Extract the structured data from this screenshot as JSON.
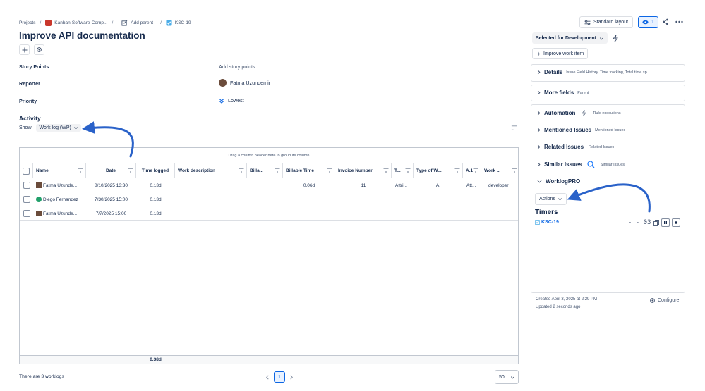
{
  "breadcrumb": {
    "projects": "Projects",
    "project": "Kanban-Software-Comp...",
    "add_parent": "Add parent",
    "issue_key": "KSC-19",
    "separator": "/"
  },
  "issue": {
    "title": "Improve API documentation"
  },
  "fields": {
    "story_points_label": "Story Points",
    "story_points_value": "Add story points",
    "reporter_label": "Reporter",
    "reporter_value": "Fatma Uzundemir",
    "priority_label": "Priority",
    "priority_value": "Lowest"
  },
  "activity": {
    "heading": "Activity",
    "show_label": "Show:",
    "show_value": "Work log (WP)"
  },
  "grid": {
    "hint": "Drag a column header here to group its column",
    "columns": [
      "Name",
      "Date",
      "Time logged",
      "Work description",
      "Billa...",
      "Billable Time",
      "Invoice Number",
      "T...",
      "Type of W...",
      "A.1",
      "Work ..."
    ],
    "rows": [
      {
        "name": "Fatma Uzunde...",
        "date": "8/10/2025 13:30",
        "time": "0.13d",
        "desc": "",
        "billa": "",
        "billable_time": "0.06d",
        "invoice": "11",
        "t": "Attri...",
        "type": "A.",
        "a1": "Att...",
        "work": "developer"
      },
      {
        "name": "Diego Fernandez",
        "date": "7/30/2025 15:00",
        "time": "0.13d",
        "desc": "",
        "billa": "",
        "billable_time": "",
        "invoice": "",
        "t": "",
        "type": "",
        "a1": "",
        "work": ""
      },
      {
        "name": "Fatma Uzunde...",
        "date": "7/7/2025 15:00",
        "time": "0.13d",
        "desc": "",
        "billa": "",
        "billable_time": "",
        "invoice": "",
        "t": "",
        "type": "",
        "a1": "",
        "work": ""
      }
    ],
    "total": "0.38d"
  },
  "footer": {
    "count_text": "There are 3 worklogs",
    "current_page": "1",
    "page_size": "50"
  },
  "header_actions": {
    "layout_label": "Standard layout",
    "watchers_count": "1"
  },
  "sidebar": {
    "status_label": "Selected for Development",
    "improve_label": "Improve work item",
    "details_label": "Details",
    "details_sub": "Issue Field History, Time tracking, Total time sp...",
    "more_fields_label": "More fields",
    "more_fields_sub": "Parent",
    "automation_label": "Automation",
    "automation_sub": "Rule executions",
    "mentioned_label": "Mentioned Issues",
    "mentioned_sub": "Mentioned Issues",
    "related_label": "Related Issues",
    "related_sub": "Related Issues",
    "similar_label": "Similar Issues",
    "similar_sub": "Similar Issues",
    "worklogpro_label": "WorklogPRO",
    "actions_label": "Actions",
    "timers_label": "Timers",
    "timer_issue": "KSC-19",
    "timer_value": "- - 03"
  },
  "meta": {
    "created": "Created April 3, 2025 at 2:29 PM",
    "updated": "Updated 2 seconds ago",
    "configure_label": "Configure"
  },
  "colors": {
    "accent": "#0c66e4",
    "arrow": "#2a62c9",
    "text": "#172b4d"
  }
}
